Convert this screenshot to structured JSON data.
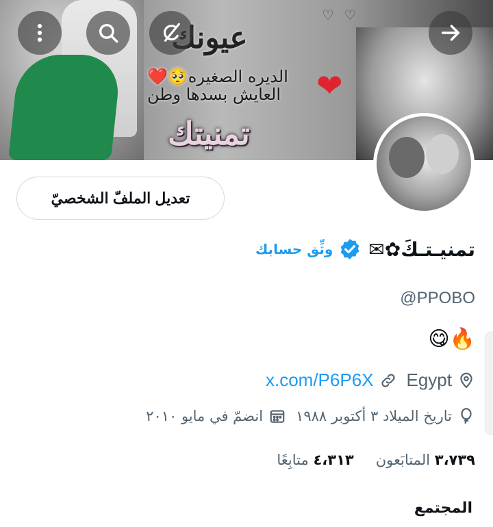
{
  "banner": {
    "title_text": "عيونك",
    "line1": "الديره الصغيره🥺❤️",
    "line2": "العايش بسدها وطن",
    "name_text": "تمنيتك",
    "heart_icon": "❤️",
    "deco": "♡ ♡"
  },
  "top_buttons": {
    "more_icon": "more-vertical-icon",
    "search_icon": "search-icon",
    "grok_icon": "grok-icon",
    "back_icon": "arrow-icon"
  },
  "profile": {
    "edit_button": "تعديل الملفّ الشخصيّ",
    "display_name": "تمنيـتـكَ✿✉",
    "verify_label": "وثِّق حسابك",
    "handle": "@PPOBO",
    "bio": "😋🔥",
    "location": "Egypt",
    "website": "x.com/P6P6X",
    "birthday": "تاريخ الميلاد ٣ أكتوبر ١٩٨٨",
    "joined": "انضمّ في مايو ٢٠١٠",
    "followers_count": "٣،٧٣٩",
    "followers_label": "المتابَعون",
    "following_count": "٤،٣١٣",
    "following_label": "متابِعًا",
    "community_label": "المجتمع"
  },
  "colors": {
    "accent": "#1d9bf0",
    "muted": "#536471",
    "text": "#0f1419",
    "border": "#cfd9de"
  }
}
